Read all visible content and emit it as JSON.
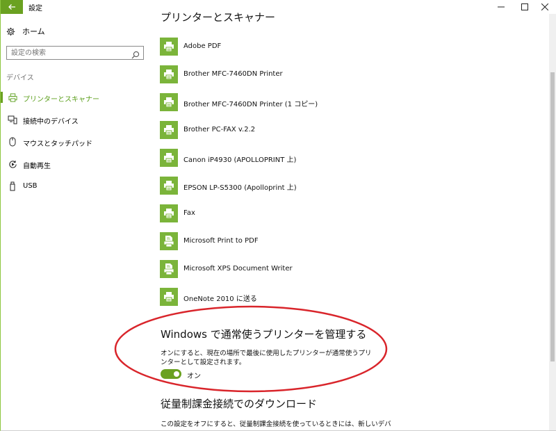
{
  "window": {
    "title": "設定",
    "controls": {
      "minimize": "─",
      "maximize": "☐",
      "close": "✕"
    }
  },
  "colors": {
    "accent": "#6aa121",
    "tile": "#7bb43a",
    "annotation": "#d9252b"
  },
  "sidebar": {
    "home_label": "ホーム",
    "search_placeholder": "設定の検索",
    "section_header": "デバイス",
    "items": [
      {
        "label": "プリンターとスキャナー",
        "icon": "printer-icon",
        "active": true
      },
      {
        "label": "接続中のデバイス",
        "icon": "connected-devices-icon",
        "active": false
      },
      {
        "label": "マウスとタッチパッド",
        "icon": "mouse-icon",
        "active": false
      },
      {
        "label": "自動再生",
        "icon": "autoplay-icon",
        "active": false
      },
      {
        "label": "USB",
        "icon": "usb-icon",
        "active": false
      }
    ]
  },
  "main": {
    "section_title": "プリンターとスキャナー",
    "printers": [
      {
        "name": "Adobe PDF",
        "icon": "printer-icon"
      },
      {
        "name": "Brother MFC-7460DN Printer",
        "icon": "printer-icon"
      },
      {
        "name": "Brother MFC-7460DN Printer (1 コピー)",
        "icon": "printer-icon"
      },
      {
        "name": "Brother PC-FAX v.2.2",
        "icon": "printer-icon"
      },
      {
        "name": "Canon iP4930 (APOLLOPRINT 上)",
        "icon": "printer-icon"
      },
      {
        "name": "EPSON LP-S5300 (Apolloprint 上)",
        "icon": "printer-icon"
      },
      {
        "name": "Fax",
        "icon": "printer-icon"
      },
      {
        "name": "Microsoft Print to PDF",
        "icon": "document-printer-icon"
      },
      {
        "name": "Microsoft XPS Document Writer",
        "icon": "document-printer-icon"
      },
      {
        "name": "OneNote 2010 に送る",
        "icon": "printer-icon"
      }
    ],
    "manage_default": {
      "title": "Windows で通常使うプリンターを管理する",
      "description": "オンにすると、現在の場所で最後に使用したプリンターが通常使うプリンターとして設定されます。",
      "toggle_on": true,
      "toggle_label": "オン"
    },
    "metered": {
      "title": "従量制課金接続でのダウンロード",
      "description": "この設定をオフにすると、従量制課金接続を使っているときには、新しいデバ"
    }
  }
}
